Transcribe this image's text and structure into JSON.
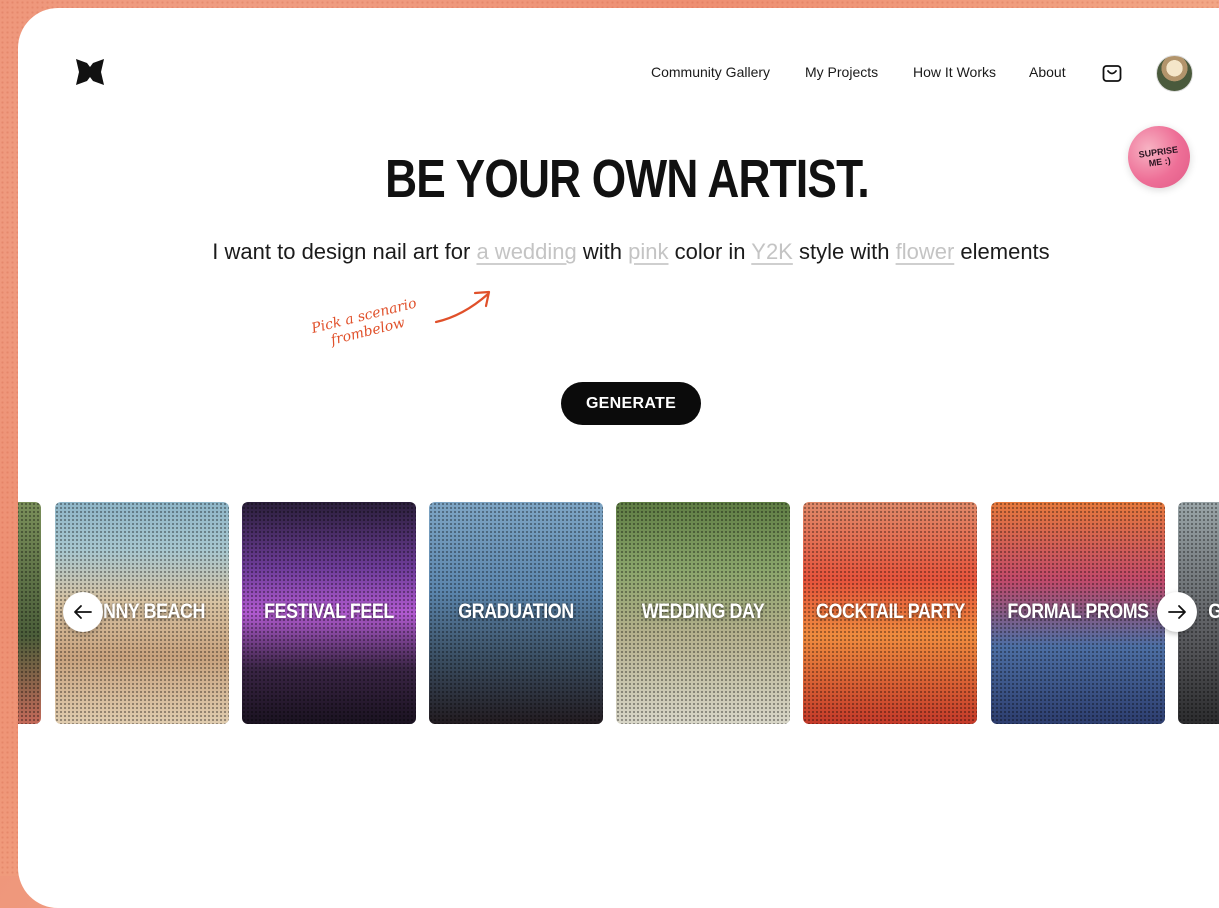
{
  "nav": {
    "links": [
      "Community Gallery",
      "My Projects",
      "How It Works",
      "About"
    ]
  },
  "icons": {
    "logo": "bowtie-logo-icon",
    "cart": "shopping-bag-icon",
    "avatar": "user-avatar",
    "prev": "arrow-left-icon",
    "next": "arrow-right-icon"
  },
  "surprise": {
    "line1": "SUPRISE",
    "line2": "ME :)"
  },
  "hero": {
    "title": "BE YOUR OWN ARTIST."
  },
  "prompt": {
    "p1": "I want to design nail art for",
    "slot_occasion": "a wedding",
    "p2": "with",
    "slot_color": "pink",
    "p3": "color in",
    "slot_style": "Y2K",
    "p4": "style with",
    "slot_element": "flower",
    "p5": "elements"
  },
  "hint": {
    "line1": "Pick a scenario",
    "line2": "frombelow"
  },
  "generate_label": "GENERATE",
  "scenarios": [
    "SUNNY BEACH",
    "FESTIVAL FEEL",
    "GRADUATION",
    "WEDDING DAY",
    "COCKTAIL PARTY",
    "FORMAL PROMS",
    "GR"
  ],
  "colors": {
    "accent": "#e0502a",
    "button": "#0b0b0b",
    "slot": "#c4c4c4"
  }
}
